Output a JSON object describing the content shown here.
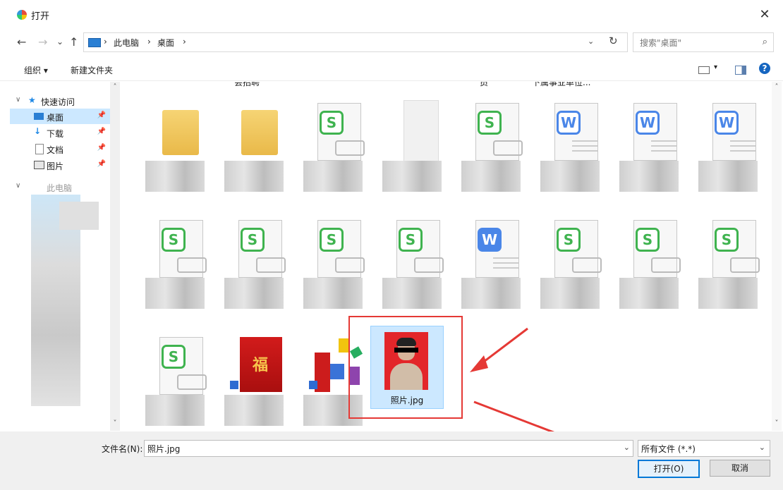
{
  "window": {
    "title": "打开",
    "close_glyph": "✕"
  },
  "nav": {
    "back": "←",
    "forward": "→",
    "recent": "⌄",
    "up": "↑",
    "refresh": "↻"
  },
  "breadcrumb": [
    "此电脑",
    "桌面"
  ],
  "search": {
    "placeholder": "搜索\"桌面\""
  },
  "toolbar": {
    "organize": "组织 ▾",
    "new_folder": "新建文件夹",
    "help": "?"
  },
  "sidebar": {
    "quick_access": "快速访问",
    "items": [
      {
        "label": "桌面"
      },
      {
        "label": "下载"
      },
      {
        "label": "文档"
      },
      {
        "label": "图片"
      }
    ],
    "this_pc_partial": "此电脑"
  },
  "content_top_labels": [
    "会招聘",
    "员",
    "下属事业单位..."
  ],
  "files": {
    "row1": [
      "folder",
      "folder",
      "wps-s",
      "map",
      "wps-s",
      "wps-w",
      "wps-w",
      "wps-w"
    ],
    "row2": [
      "wps-s",
      "wps-s",
      "wps-s",
      "wps-s",
      "wps-w-filled",
      "wps-s",
      "wps-s",
      "wps-s"
    ],
    "row3": [
      "wps-s",
      "red-folder",
      "blocks"
    ],
    "selected_file": "照片.jpg"
  },
  "bottom": {
    "filename_label": "文件名(N):",
    "filename_value": "照片.jpg",
    "filetype_value": "所有文件 (*.*)",
    "open_button": "打开(O)",
    "cancel_button": "取消"
  },
  "accent": {
    "selection": "#cce8ff",
    "callout": "#e53935",
    "primary_border": "#0078d7"
  }
}
